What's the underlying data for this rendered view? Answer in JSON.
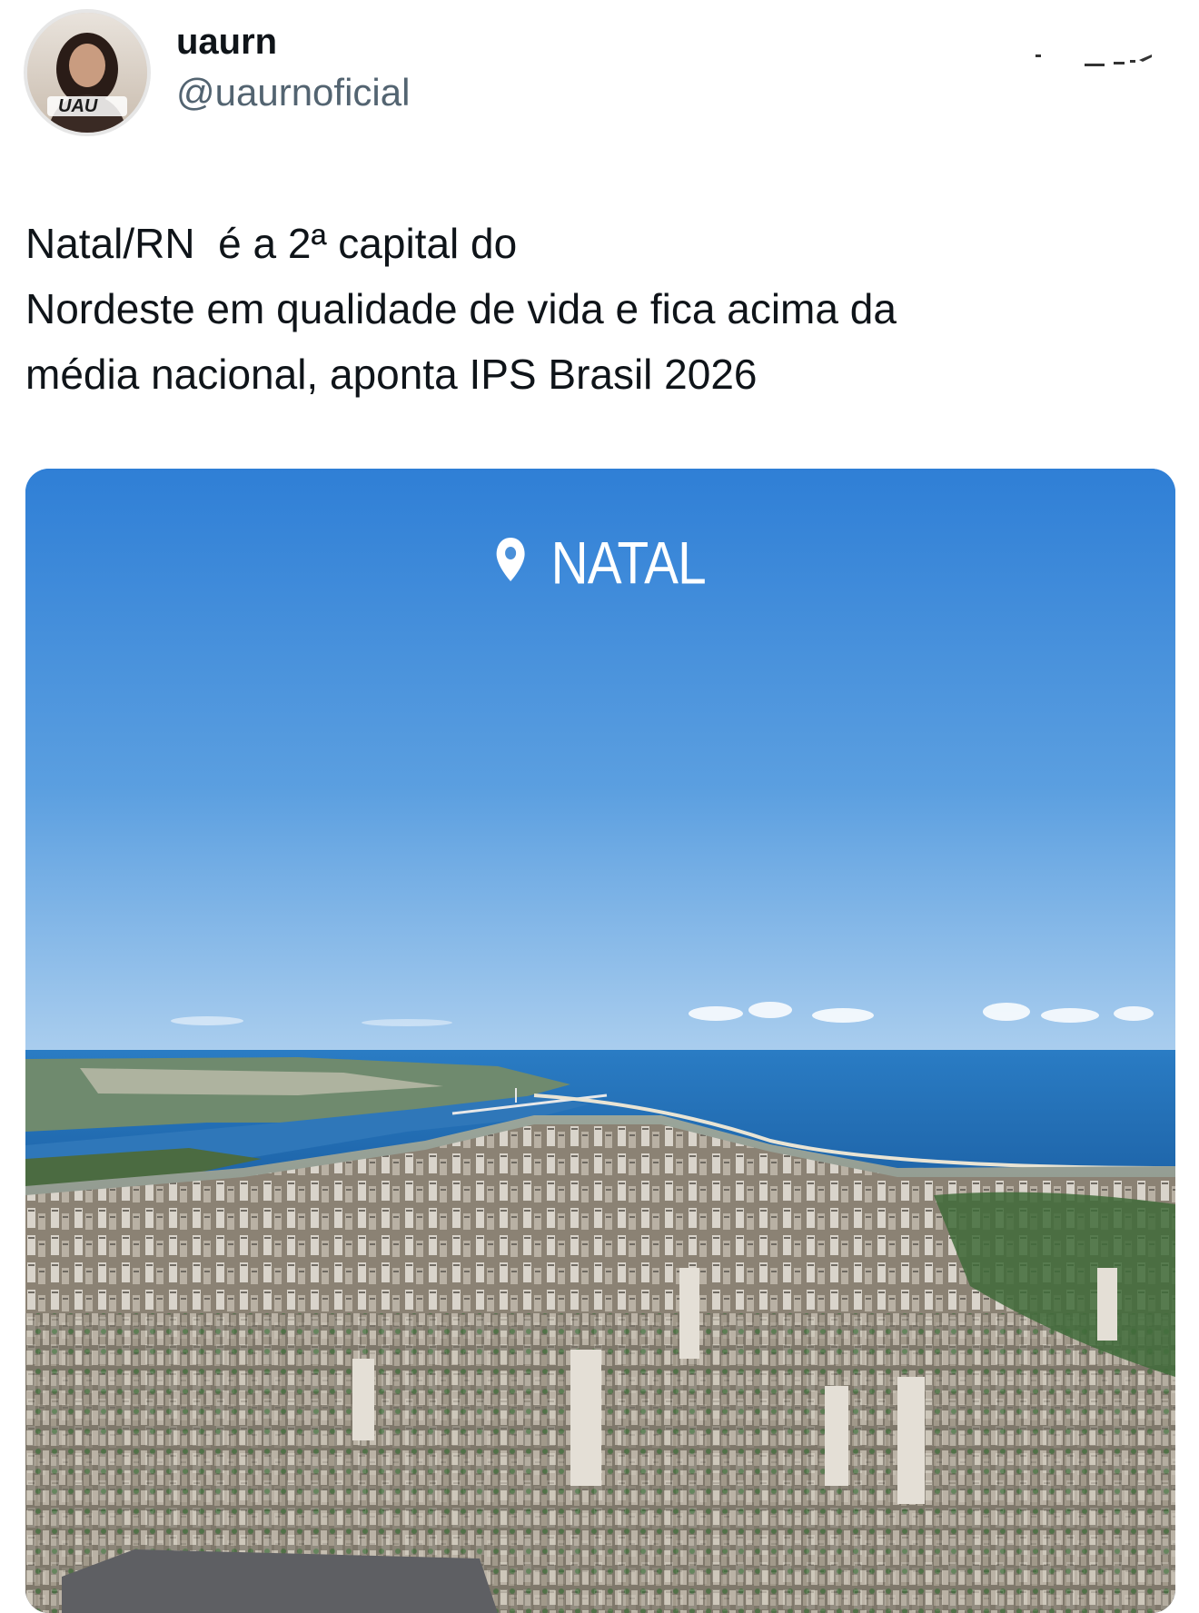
{
  "tweet": {
    "author": {
      "display_name": "uaurn",
      "handle": "@uaurnoficial",
      "avatar_badge_text": "UAU"
    },
    "text_lines": [
      "Natal/RN  é a 2ª capital do",
      "Nordeste em qualidade de vida e fica acima da",
      "média nacional, aponta IPS Brasil 2026"
    ],
    "media": {
      "location_label": "NATAL",
      "location_icon": "map-pin-icon"
    }
  },
  "colors": {
    "handle": "#536471",
    "text": "#0f1419",
    "sky_top": "#2f7fd6",
    "sky_horizon": "#a9cdee",
    "sea": "#1f6fb8"
  }
}
